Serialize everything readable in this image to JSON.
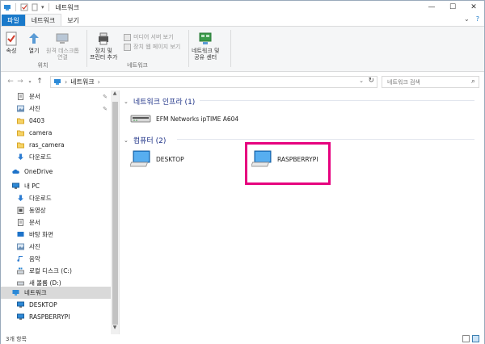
{
  "window": {
    "title": "네트워크",
    "controls": {
      "minimize": "—",
      "maximize": "☐",
      "close": "✕"
    }
  },
  "ribbon_tabs": [
    {
      "label": "파일"
    },
    {
      "label": "네트워크"
    },
    {
      "label": "보기"
    }
  ],
  "ribbon": {
    "groups": {
      "location": {
        "label": "위치",
        "buttons": {
          "properties": "속성",
          "open": "열기",
          "connect": "원격 데스크톱",
          "connect2": "연결"
        }
      },
      "network": {
        "label": "네트워크",
        "add_device": "장치 및",
        "add_device2": "프린터 추가",
        "media": "미디어 서버 보기",
        "device_page": "장치 웹 페이지 보기"
      },
      "center": {
        "line1": "네트워크 및",
        "line2": "공유 센터"
      }
    }
  },
  "address": {
    "path": "네트워크",
    "separator": "›",
    "search_placeholder": "네트워크 검색"
  },
  "sidebar": {
    "items": [
      {
        "label": "문서",
        "pinned": true
      },
      {
        "label": "사진",
        "pinned": true
      },
      {
        "label": "0403"
      },
      {
        "label": "camera"
      },
      {
        "label": "ras_camera"
      },
      {
        "label": "다운로드"
      },
      {
        "label": "OneDrive"
      },
      {
        "label": "내 PC"
      },
      {
        "label": "다운로드"
      },
      {
        "label": "동영상"
      },
      {
        "label": "문서"
      },
      {
        "label": "바탕 화면"
      },
      {
        "label": "사진"
      },
      {
        "label": "음악"
      },
      {
        "label": "로컬 디스크 (C:)"
      },
      {
        "label": "새 볼륨 (D:)"
      },
      {
        "label": "네트워크"
      },
      {
        "label": "DESKTOP"
      },
      {
        "label": "RASPBERRYPI"
      }
    ]
  },
  "content": {
    "groups": [
      {
        "title": "네트워크 인프라 (1)",
        "items": [
          {
            "label": "EFM Networks ipTIME A604"
          }
        ]
      },
      {
        "title": "컴퓨터 (2)",
        "items": [
          {
            "label": "DESKTOP"
          },
          {
            "label": "RASPBERRYPI"
          }
        ]
      }
    ]
  },
  "statusbar": {
    "text": "3개 항목"
  },
  "colors": {
    "file_tab": "#1979ca",
    "highlight": "#e6007e",
    "group_title": "#1e3287"
  }
}
